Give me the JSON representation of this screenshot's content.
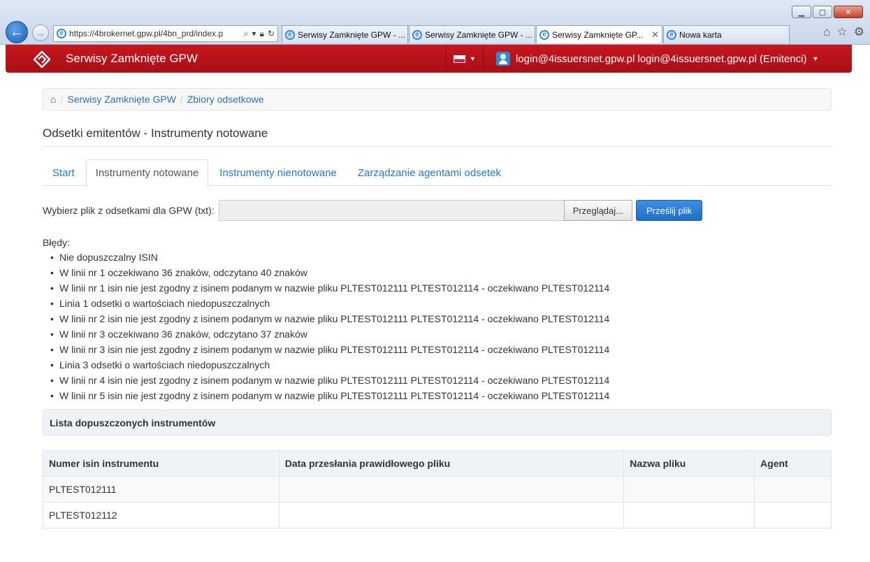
{
  "browser": {
    "address_url": "https://4brokernet.gpw.pl/4bn_prd/index.p",
    "tabs": [
      {
        "label": "Serwisy Zamknięte GPW - ..."
      },
      {
        "label": "Serwisy Zamknięte GPW - ..."
      },
      {
        "label": "Serwisy Zamknięte GP..."
      },
      {
        "label": "Nowa karta"
      }
    ]
  },
  "header": {
    "title": "Serwisy Zamknięte GPW",
    "user": "login@4issuersnet.gpw.pl login@4issuersnet.gpw.pl (Emitenci)",
    "accent": "#b5121b"
  },
  "breadcrumb": [
    "Serwisy Zamknięte GPW",
    "Zbiory odsetkowe"
  ],
  "page_title": "Odsetki emitentów - Instrumenty notowane",
  "tabs": [
    "Start",
    "Instrumenty notowane",
    "Instrumenty nienotowane",
    "Zarządzanie agentami odsetek"
  ],
  "upload": {
    "label": "Wybierz plik z odsetkami dla GPW (txt):",
    "browse": "Przeglądaj...",
    "submit": "Prześlij plik"
  },
  "errors": {
    "title": "Błędy:",
    "items": [
      "Nie dopuszczalny ISIN",
      "W linii nr 1 oczekiwano 36 znaków, odczytano 40 znaków",
      "W linii nr 1 isin nie jest zgodny z isinem podanym w nazwie pliku PLTEST012111 PLTEST012114 - oczekiwano PLTEST012114",
      "Linia 1 odsetki o wartościach niedopuszczalnych",
      "W linii nr 2 isin nie jest zgodny z isinem podanym w nazwie pliku PLTEST012111 PLTEST012114 - oczekiwano PLTEST012114",
      "W linii nr 3 oczekiwano 36 znaków, odczytano 37 znaków",
      "W linii nr 3 isin nie jest zgodny z isinem podanym w nazwie pliku PLTEST012111 PLTEST012114 - oczekiwano PLTEST012114",
      "Linia 3 odsetki o wartościach niedopuszczalnych",
      "W linii nr 4 isin nie jest zgodny z isinem podanym w nazwie pliku PLTEST012111 PLTEST012114 - oczekiwano PLTEST012114",
      "W linii nr 5 isin nie jest zgodny z isinem podanym w nazwie pliku PLTEST012111 PLTEST012114 - oczekiwano PLTEST012114"
    ]
  },
  "panel": {
    "title": "Lista dopuszczonych instrumentów"
  },
  "table": {
    "headers": [
      "Numer isin instrumentu",
      "Data przesłania prawidłowego pliku",
      "Nazwa pliku",
      "Agent"
    ],
    "rows": [
      [
        "PLTEST012111",
        "",
        "",
        ""
      ],
      [
        "PLTEST012112",
        "",
        "",
        ""
      ]
    ]
  }
}
